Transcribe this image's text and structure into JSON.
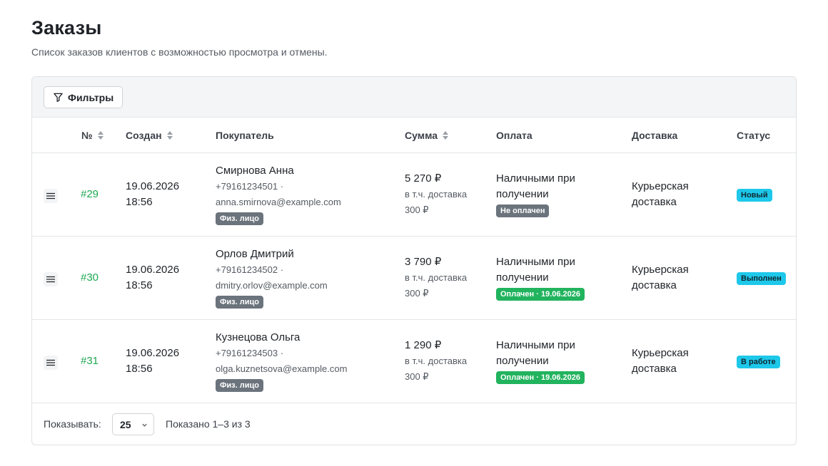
{
  "page": {
    "title": "Заказы",
    "subtitle": "Список заказов клиентов с возможностью просмотра и отмены."
  },
  "toolbar": {
    "filter_label": "Фильтры",
    "filter_icon": "filter-icon"
  },
  "table": {
    "columns": {
      "number": "№",
      "created": "Создан",
      "customer": "Покупатель",
      "sum": "Сумма",
      "payment": "Оплата",
      "delivery": "Доставка",
      "status": "Статус"
    },
    "rows": [
      {
        "number": "#29",
        "date": "19.06.2026",
        "time": "18:56",
        "customer_name": "Смирнова Анна",
        "phone": "+79161234501 ·",
        "email": "anna.smirnova@example.com",
        "customer_type": "Физ. лицо",
        "sum": "5 270 ₽",
        "delivery_note": "в т.ч. доставка",
        "delivery_cost": "300 ₽",
        "payment_line1": "Наличными при",
        "payment_line2": "получении",
        "payment_badge": "Не оплачен",
        "delivery_line1": "Курьерская",
        "delivery_line2": "доставка",
        "status": "Новый"
      },
      {
        "number": "#30",
        "date": "19.06.2026",
        "time": "18:56",
        "customer_name": "Орлов Дмитрий",
        "phone": "+79161234502 ·",
        "email": "dmitry.orlov@example.com",
        "customer_type": "Физ. лицо",
        "sum": "3 790 ₽",
        "delivery_note": "в т.ч. доставка",
        "delivery_cost": "300 ₽",
        "payment_line1": "Наличными при",
        "payment_line2": "получении",
        "payment_badge": "Оплачен · 19.06.2026",
        "delivery_line1": "Курьерская",
        "delivery_line2": "доставка",
        "status": "Выполнен"
      },
      {
        "number": "#31",
        "date": "19.06.2026",
        "time": "18:56",
        "customer_name": "Кузнецова Ольга",
        "phone": "+79161234503 ·",
        "email": "olga.kuznetsova@example.com",
        "customer_type": "Физ. лицо",
        "sum": "1 290 ₽",
        "delivery_note": "в т.ч. доставка",
        "delivery_cost": "300 ₽",
        "payment_line1": "Наличными при",
        "payment_line2": "получении",
        "payment_badge": "Оплачен · 19.06.2026",
        "delivery_line1": "Курьерская",
        "delivery_line2": "доставка",
        "status": "В работе"
      }
    ]
  },
  "footer": {
    "show_label": "Показывать:",
    "page_size": "25",
    "summary": "Показано 1–3 из 3"
  },
  "colors": {
    "link_green": "#1ea851",
    "badge_gray": "#6b737c",
    "badge_green": "#22b35e",
    "badge_cyan": "#1ec8ea"
  }
}
